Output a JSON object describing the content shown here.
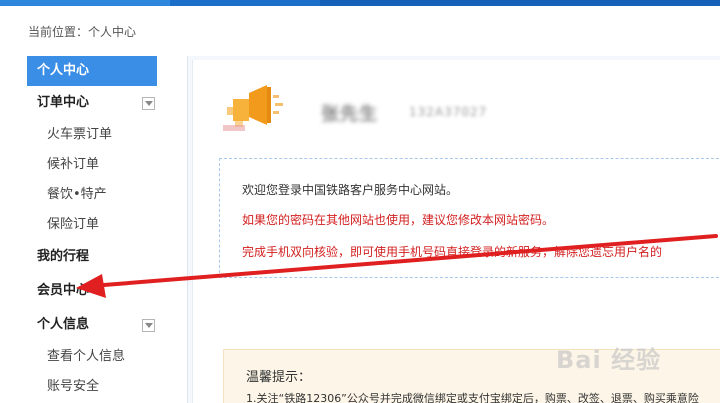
{
  "breadcrumb": "当前位置：个人中心",
  "sidebar": {
    "head": "个人中心",
    "groups": [
      {
        "label": "订单中心",
        "items": [
          "火车票订单",
          "候补订单",
          "餐饮•特产",
          "保险订单"
        ]
      },
      {
        "label": "我的行程"
      },
      {
        "label": "会员中心"
      },
      {
        "label": "个人信息",
        "items": [
          "查看个人信息",
          "账号安全"
        ]
      }
    ]
  },
  "profile": {
    "name": "张先生",
    "id": "132A37027"
  },
  "welcome": {
    "line1": "欢迎您登录中国铁路客户服务中心网站。",
    "line2": "如果您的密码在其他网站也使用，建议您修改本网站密码。",
    "line3": "完成手机双向核验，即可使用手机号码直接登录的新服务，解除您遗忘用户名的"
  },
  "tips": {
    "title": "温馨提示：",
    "line1": "1.关注“铁路12306”公众号并完成微信绑定或支付宝绑定后，购票、改签、退票、购买乘意险"
  },
  "watermark": "Bai 经验",
  "colors": {
    "accent": "#3a8ee6",
    "warning": "#d32020",
    "annotation_arrow": "#e02020"
  }
}
